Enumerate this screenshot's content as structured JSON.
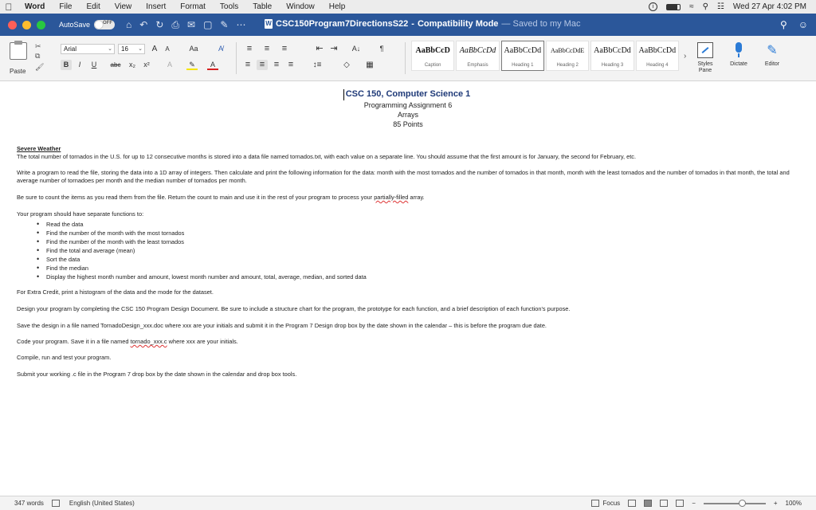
{
  "menubar": {
    "app": "Word",
    "items": [
      "File",
      "Edit",
      "View",
      "Insert",
      "Format",
      "Tools",
      "Table",
      "Window",
      "Help"
    ],
    "clock": "Wed 27 Apr  4:02 PM"
  },
  "titlebar": {
    "autosave_label": "AutoSave",
    "autosave_state": "OFF",
    "doc_name": "CSC150Program7DirectionsS22",
    "mode": "Compatibility Mode",
    "saved": "— Saved to my Mac"
  },
  "ribbon": {
    "paste_label": "Paste",
    "font_name": "Arial",
    "font_size": "16",
    "bold": "B",
    "italic": "I",
    "underline": "U",
    "strike": "abc",
    "subscript": "x₂",
    "superscript": "x²",
    "grow": "A",
    "shrink": "A",
    "change_case": "Aa",
    "sort": "A↓",
    "pilcrow": "¶",
    "styles": [
      {
        "sample": "AaBbCcD",
        "label": "Caption"
      },
      {
        "sample": "AaBbCcDd",
        "label": "Emphasis"
      },
      {
        "sample": "AaBbCcDd",
        "label": "Heading 1"
      },
      {
        "sample": "AaBbCcDdE",
        "label": "Heading 2"
      },
      {
        "sample": "AaBbCcDd",
        "label": "Heading 3"
      },
      {
        "sample": "AaBbCcDd",
        "label": "Heading 4"
      }
    ],
    "styles_pane": "Styles Pane",
    "dictate": "Dictate",
    "editor": "Editor"
  },
  "document": {
    "title": "CSC 150, Computer Science 1",
    "subtitle": "Programming Assignment 6",
    "topic": "Arrays",
    "points": "85 Points",
    "heading": "Severe Weather",
    "p1": "The total number of tornados in the U.S. for up to 12 consecutive months is stored into a data file named tornados.txt, with each value on a separate line.  You should assume that the first amount is for January, the second for February, etc.",
    "p2": "Write a program to read the file, storing the data into a 1D array of integers.  Then calculate and print the following information for the data:  month with the most tornados and the number of tornados in that month, month with the least tornados and the number of tornados in that month, the total and average number of tornadoes per month and the median number of tornados per month.",
    "p3_before": "Be sure to count the items as you read them from the file.  Return the count to main and use it in the rest of your program to process your ",
    "p3_underlined": "partially-filled",
    "p3_after": " array.",
    "p4": "Your program should have separate functions to:",
    "bullets": [
      "Read the data",
      "Find the number of the month with the most tornados",
      "Find the number of the month with the least tornados",
      "Find the total and average (mean)",
      "Sort the data",
      "Find the median",
      "Display the highest month number and amount, lowest month number and amount, total, average, median, and sorted data"
    ],
    "p5": "For Extra Credit, print a histogram of the data and the mode for the dataset.",
    "p6": "Design your program by completing the CSC 150 Program Design Document.  Be sure to include a structure chart for the program, the prototype for each function, and a brief description of each function's purpose.",
    "p7": "Save the design in a file named TornadoDesign_xxx.doc where xxx are your initials and submit it in the Program 7 Design drop box by the date shown in the calendar – this is before the program due date.",
    "p8_before": "Code your program.  Save it in a file named ",
    "p8_underlined": "tornado_xxx.c",
    "p8_after": " where xxx are your initials.",
    "p9": "Compile, run and test your program.",
    "p10": "Submit your working .c file in the Program 7 drop box by the date shown in the calendar and drop box tools."
  },
  "statusbar": {
    "words": "347 words",
    "language": "English (United States)",
    "focus": "Focus",
    "zoom": "100%"
  },
  "colors": {
    "titlebar": "#2b579a",
    "doc_title": "#1f3a78"
  }
}
